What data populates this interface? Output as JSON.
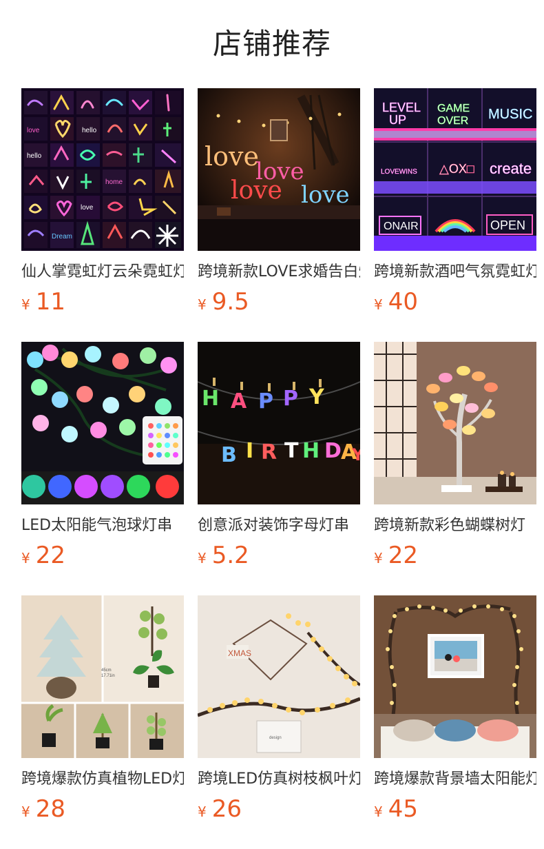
{
  "page": {
    "title": "店铺推荐"
  },
  "products": [
    {
      "name": "仙人掌霓虹灯云朵霓虹灯",
      "currency": "¥",
      "price": "11",
      "image_icon": "neon-sign-collage-image",
      "accent": "#ff4fd8"
    },
    {
      "name": "跨境新款LOVE求婚告白灯",
      "currency": "¥",
      "price": "9.5",
      "image_icon": "love-neon-sign-image",
      "accent": "#ff3a73"
    },
    {
      "name": "跨境新款酒吧气氛霓虹灯",
      "currency": "¥",
      "price": "40",
      "image_icon": "bar-neon-signs-image",
      "accent": "#5cc8ff"
    },
    {
      "name": "LED太阳能气泡球灯串",
      "currency": "¥",
      "price": "22",
      "image_icon": "bubble-ball-string-lights-image",
      "accent": "#ff4f8b"
    },
    {
      "name": "创意派对装饰字母灯串",
      "currency": "¥",
      "price": "5.2",
      "image_icon": "happy-birthday-letter-lights-image",
      "accent": "#3ee5ff"
    },
    {
      "name": "跨境新款彩色蝴蝶树灯",
      "currency": "¥",
      "price": "22",
      "image_icon": "butterfly-tree-lamp-image",
      "accent": "#ffb34d"
    },
    {
      "name": "跨境爆款仿真植物LED灯",
      "currency": "¥",
      "price": "28",
      "image_icon": "artificial-plant-led-image",
      "accent": "#79b35b"
    },
    {
      "name": "跨境LED仿真树枝枫叶灯",
      "currency": "¥",
      "price": "26",
      "image_icon": "led-branch-light-image",
      "accent": "#ffcc66"
    },
    {
      "name": "跨境爆款背景墙太阳能灯",
      "currency": "¥",
      "price": "45",
      "image_icon": "wall-branch-lights-image",
      "accent": "#ffd36e"
    }
  ],
  "colors": {
    "price": "#ea5a24",
    "title": "#222222",
    "text": "#333333",
    "background": "#ffffff"
  }
}
